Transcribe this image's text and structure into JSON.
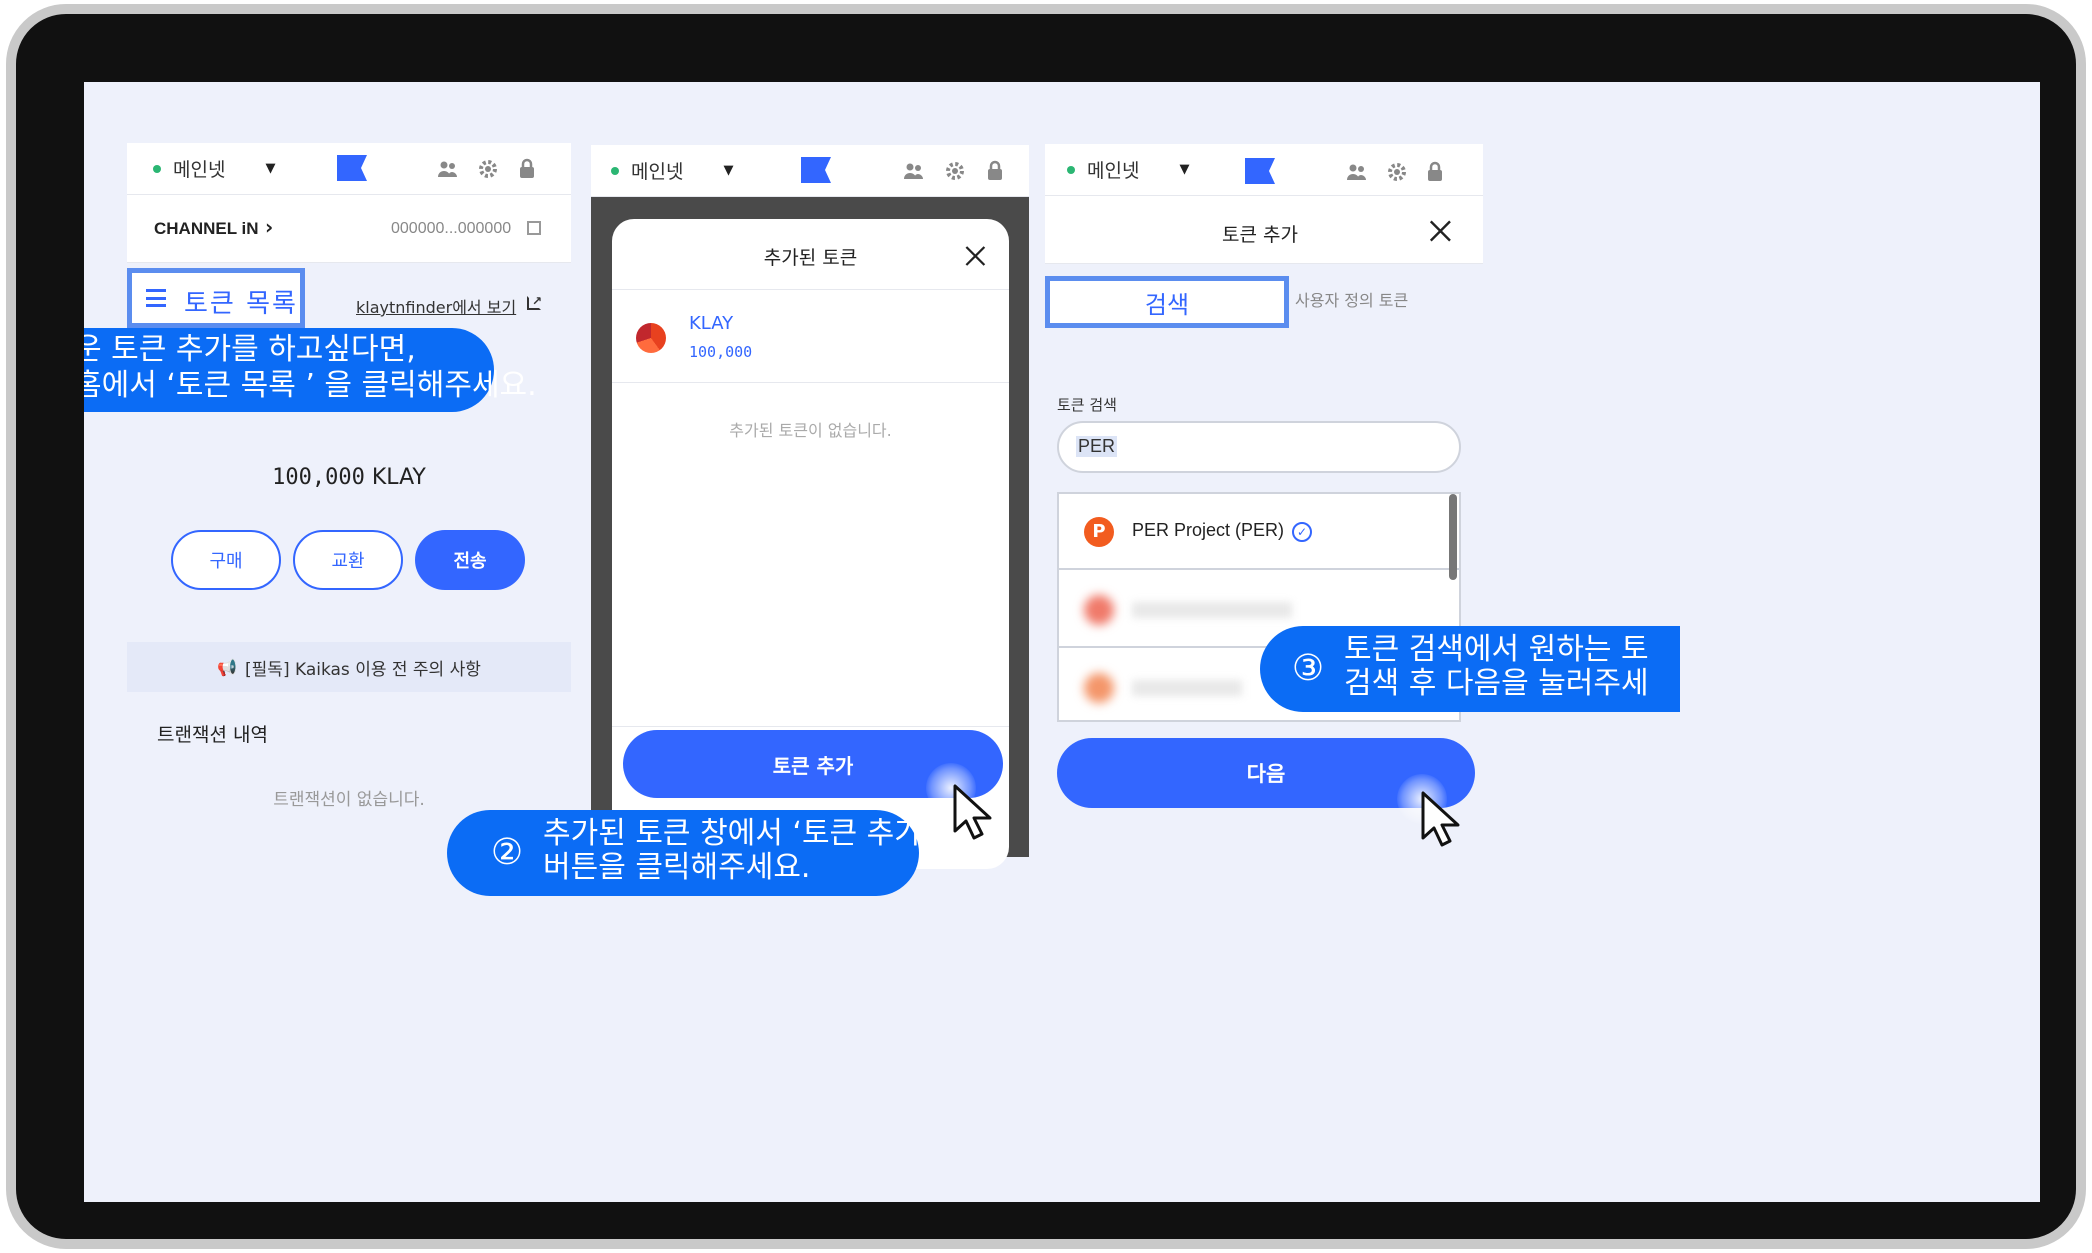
{
  "network": {
    "label": "메인넷"
  },
  "panel1": {
    "account_name": "CHANNEL iN",
    "account_address": "000000...000000",
    "token_list_label": "토큰 목록",
    "finder_link": "klaytnfinder에서 보기",
    "balance": "100,000",
    "balance_unit": "KLAY",
    "buttons": {
      "buy": "구매",
      "swap": "교환",
      "send": "전송"
    },
    "notice": "[필독] Kaikas 이용 전 주의 사항",
    "tx_title": "트랜잭션 내역",
    "tx_empty": "트랜잭션이 없습니다."
  },
  "panel2": {
    "title": "추가된 토큰",
    "token_name": "KLAY",
    "token_balance": "100,000",
    "empty_text": "추가된 토큰이 없습니다.",
    "add_button": "토큰 추가"
  },
  "panel3": {
    "title": "토큰 추가",
    "tab_search": "검색",
    "tab_custom": "사용자 정의 토큰",
    "search_label": "토큰 검색",
    "search_value": "PER",
    "result_1": "PER Project (PER)",
    "next_button": "다음"
  },
  "callouts": {
    "step1_line1": "운 토큰 추가를 하고싶다면,",
    "step1_line2": "홈에서 ‘토큰 목록 ’ 을 클릭해주세요.",
    "step2_num": "②",
    "step2_line1": "추가된 토큰 창에서 ‘토큰 추가’",
    "step2_line2": "버튼을 클릭해주세요.",
    "step3_num": "③",
    "step3_line1": "토큰 검색에서 원하는 토",
    "step3_line2": "검색 후 다음을 눌러주세"
  },
  "colors": {
    "accent": "#3366ff",
    "callout": "#0b6cf5",
    "highlight_border": "#5b8def"
  }
}
